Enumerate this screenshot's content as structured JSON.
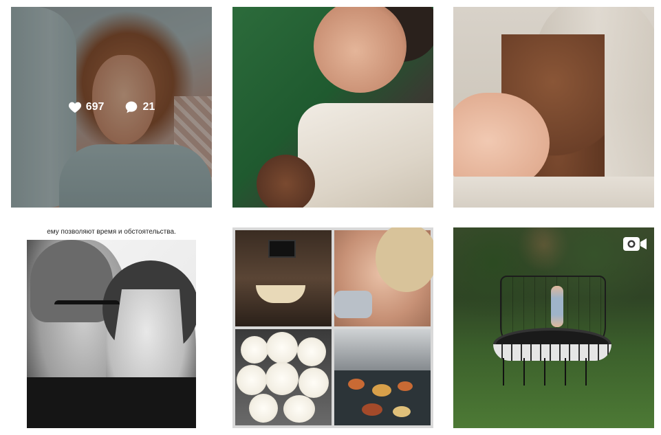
{
  "grid": {
    "posts": [
      {
        "id_label": "post-1",
        "alt": "selfie",
        "likes": "697",
        "comments": "21",
        "hovered": true
      },
      {
        "id_label": "post-2"
      },
      {
        "id_label": "post-3"
      },
      {
        "id_label": "post-4",
        "caption": "ему позволяют время и обстоятельства."
      },
      {
        "id_label": "post-5"
      },
      {
        "id_label": "post-6",
        "type": "video",
        "icon": "video-camera-icon"
      }
    ]
  },
  "colors": {
    "overlay": "rgba(0,0,0,0.3)",
    "overlay_text": "#ffffff"
  },
  "icons": {
    "likes": "heart-icon",
    "comments": "comment-bubble-icon",
    "video": "video-camera-icon"
  }
}
